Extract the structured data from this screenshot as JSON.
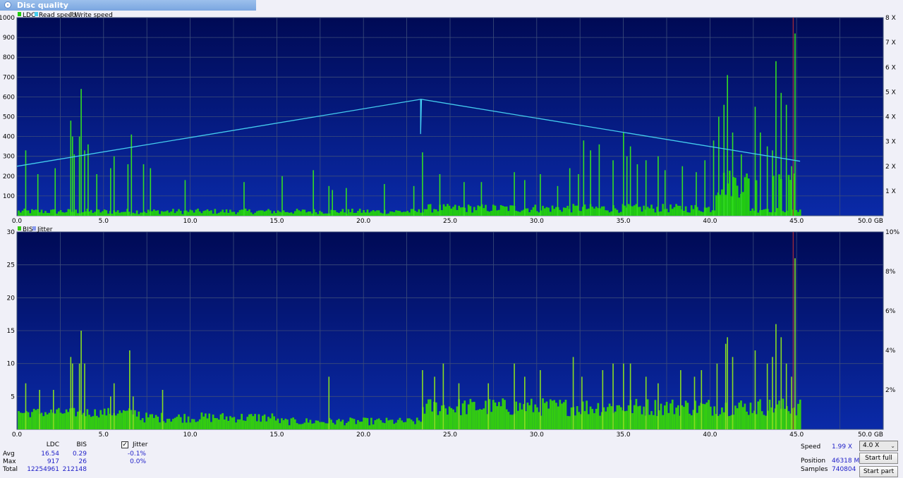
{
  "window": {
    "title": "Disc quality"
  },
  "legend_top": {
    "ldc": "LDC",
    "read": "Read speed",
    "write": "Write speed"
  },
  "legend_bottom": {
    "bis": "BIS",
    "jitter": "Jitter"
  },
  "colors": {
    "background": "#000e70",
    "bar": "#22cc11",
    "bis_bar": "#33cc11",
    "read_speed": "#44ccee",
    "grid": "#3d4d7a",
    "marker": "#cc3333"
  },
  "chart_data": [
    {
      "type": "bar",
      "name": "ldc-chart",
      "x_unit": "GB",
      "xlim": [
        0,
        50
      ],
      "x_ticks": [
        "0.0",
        "5.0",
        "10.0",
        "15.0",
        "20.0",
        "25.0",
        "30.0",
        "35.0",
        "40.0",
        "45.0",
        "50.0 GB"
      ],
      "ylim": [
        0,
        1000
      ],
      "y_ticks": [
        "1000",
        "900",
        "800",
        "700",
        "600",
        "500",
        "400",
        "300",
        "200",
        "100"
      ],
      "y2lim": [
        0,
        8
      ],
      "y2_ticks": [
        "8 X",
        "7 X",
        "6 X",
        "5 X",
        "4 X",
        "3 X",
        "2 X",
        "1 X"
      ],
      "scan_end_gb": 45.2,
      "marker_gb": 44.8,
      "ldc_spikes": [
        [
          0.5,
          330
        ],
        [
          1.2,
          210
        ],
        [
          2.2,
          240
        ],
        [
          3.1,
          480
        ],
        [
          3.2,
          400
        ],
        [
          3.3,
          310
        ],
        [
          3.6,
          400
        ],
        [
          3.7,
          640
        ],
        [
          3.9,
          330
        ],
        [
          4.1,
          360
        ],
        [
          4.6,
          210
        ],
        [
          5.4,
          240
        ],
        [
          5.6,
          300
        ],
        [
          6.4,
          260
        ],
        [
          6.6,
          410
        ],
        [
          7.3,
          260
        ],
        [
          7.7,
          240
        ],
        [
          9.7,
          180
        ],
        [
          13.1,
          170
        ],
        [
          15.3,
          200
        ],
        [
          17.1,
          230
        ],
        [
          18.0,
          150
        ],
        [
          18.2,
          130
        ],
        [
          19.0,
          140
        ],
        [
          21.2,
          160
        ],
        [
          22.9,
          150
        ],
        [
          23.4,
          320
        ],
        [
          24.4,
          210
        ],
        [
          25.8,
          170
        ],
        [
          26.8,
          170
        ],
        [
          28.7,
          220
        ],
        [
          29.3,
          180
        ],
        [
          30.2,
          210
        ],
        [
          31.2,
          150
        ],
        [
          31.9,
          240
        ],
        [
          32.4,
          210
        ],
        [
          32.7,
          380
        ],
        [
          33.1,
          330
        ],
        [
          33.6,
          360
        ],
        [
          34.4,
          280
        ],
        [
          35.0,
          420
        ],
        [
          35.2,
          300
        ],
        [
          35.4,
          350
        ],
        [
          35.8,
          260
        ],
        [
          36.3,
          280
        ],
        [
          37.0,
          300
        ],
        [
          37.4,
          230
        ],
        [
          38.4,
          250
        ],
        [
          39.2,
          220
        ],
        [
          39.7,
          280
        ],
        [
          40.2,
          380
        ],
        [
          40.5,
          500
        ],
        [
          40.8,
          560
        ],
        [
          41.0,
          710
        ],
        [
          41.3,
          420
        ],
        [
          41.8,
          310
        ],
        [
          42.6,
          550
        ],
        [
          42.9,
          420
        ],
        [
          43.3,
          350
        ],
        [
          43.6,
          330
        ],
        [
          43.8,
          780
        ],
        [
          44.1,
          620
        ],
        [
          44.4,
          560
        ],
        [
          44.7,
          250
        ],
        [
          44.9,
          920
        ]
      ],
      "read_speed": {
        "x": [
          0,
          23.3,
          23.3,
          23.35,
          45.2
        ],
        "y": [
          2.0,
          4.7,
          3.3,
          4.7,
          2.2
        ]
      }
    },
    {
      "type": "bar",
      "name": "bis-chart",
      "x_unit": "GB",
      "xlim": [
        0,
        50
      ],
      "x_ticks": [
        "0.0",
        "5.0",
        "10.0",
        "15.0",
        "20.0",
        "25.0",
        "30.0",
        "35.0",
        "40.0",
        "45.0",
        "50.0 GB"
      ],
      "ylim": [
        0,
        30
      ],
      "y_ticks": [
        "30",
        "25",
        "20",
        "15",
        "10",
        "5"
      ],
      "y2lim": [
        0,
        10
      ],
      "y2_ticks": [
        "10%",
        "8%",
        "6%",
        "4%",
        "2%"
      ],
      "scan_end_gb": 45.2,
      "marker_gb": 44.8,
      "bis_spikes": [
        [
          0.5,
          7
        ],
        [
          1.3,
          6
        ],
        [
          2.1,
          6
        ],
        [
          3.1,
          11
        ],
        [
          3.2,
          10
        ],
        [
          3.6,
          10
        ],
        [
          3.7,
          15
        ],
        [
          3.9,
          10
        ],
        [
          5.4,
          5
        ],
        [
          5.6,
          7
        ],
        [
          6.5,
          12
        ],
        [
          6.7,
          5
        ],
        [
          8.4,
          6
        ],
        [
          18.0,
          8
        ],
        [
          23.4,
          9
        ],
        [
          24.1,
          8
        ],
        [
          24.6,
          10
        ],
        [
          25.5,
          7
        ],
        [
          27.2,
          7
        ],
        [
          28.7,
          10
        ],
        [
          29.3,
          8
        ],
        [
          30.2,
          9
        ],
        [
          32.1,
          11
        ],
        [
          32.6,
          8
        ],
        [
          33.8,
          9
        ],
        [
          34.4,
          10
        ],
        [
          35.0,
          10
        ],
        [
          35.4,
          10
        ],
        [
          36.3,
          8
        ],
        [
          37.0,
          7
        ],
        [
          38.3,
          9
        ],
        [
          39.1,
          8
        ],
        [
          39.5,
          9
        ],
        [
          40.4,
          10
        ],
        [
          40.9,
          13
        ],
        [
          41.0,
          14
        ],
        [
          41.3,
          11
        ],
        [
          42.6,
          12
        ],
        [
          43.3,
          10
        ],
        [
          43.6,
          11
        ],
        [
          43.8,
          16
        ],
        [
          44.1,
          14
        ],
        [
          44.4,
          10
        ],
        [
          44.7,
          8
        ],
        [
          44.9,
          26
        ]
      ]
    }
  ],
  "stats": {
    "col_ldc": "LDC",
    "col_bis": "BIS",
    "jitter_label": "Jitter",
    "avg_label": "Avg",
    "max_label": "Max",
    "total_label": "Total",
    "avg_ldc": "16.54",
    "avg_bis": "0.29",
    "avg_jitter": "-0.1%",
    "max_ldc": "917",
    "max_bis": "26",
    "max_jitter": "0.0%",
    "total_ldc": "12254961",
    "total_bis": "212148",
    "jitter_checked": "✓"
  },
  "info": {
    "speed_label": "Speed",
    "speed_value": "1.99 X",
    "position_label": "Position",
    "position_value": "46318 MB",
    "samples_label": "Samples",
    "samples_value": "740804"
  },
  "controls": {
    "speed_select": "4.0 X",
    "start_full": "Start full",
    "start_part": "Start part"
  }
}
